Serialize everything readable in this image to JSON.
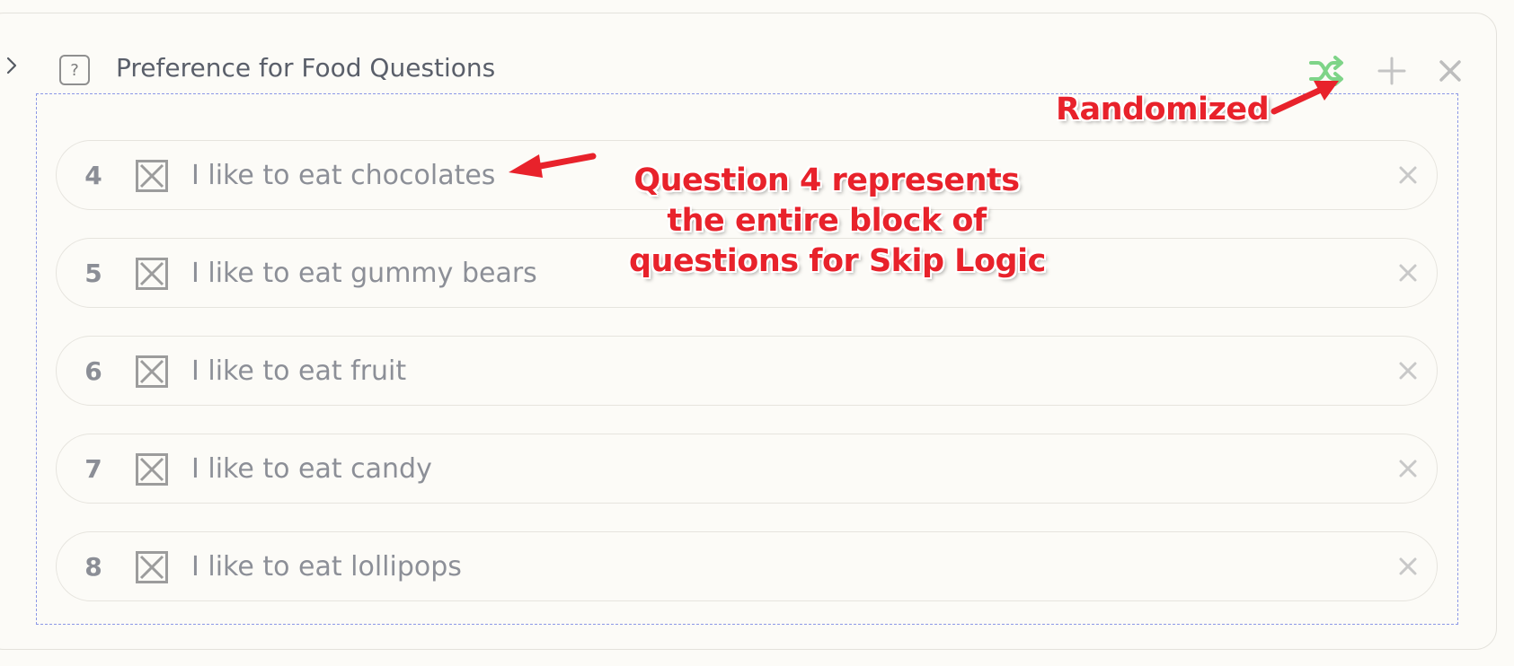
{
  "block": {
    "title": "Preference for Food Questions",
    "question_icon_glyph": "?",
    "shuffle_color": "#7ed488",
    "icons": [
      "chevron-right-icon",
      "question-icon",
      "shuffle-icon",
      "plus-icon",
      "close-icon"
    ]
  },
  "questions": [
    {
      "number": "4",
      "text": "I like to eat chocolates"
    },
    {
      "number": "5",
      "text": "I like to eat gummy bears"
    },
    {
      "number": "6",
      "text": "I like to eat fruit"
    },
    {
      "number": "7",
      "text": "I like to eat candy"
    },
    {
      "number": "8",
      "text": "I like to eat lollipops"
    }
  ],
  "annotations": {
    "randomized": "Randomized",
    "skip_logic_line1": "Question 4 represents",
    "skip_logic_line2": "the entire block of",
    "skip_logic_line3": "questions for Skip Logic",
    "color": "#e8222b"
  }
}
